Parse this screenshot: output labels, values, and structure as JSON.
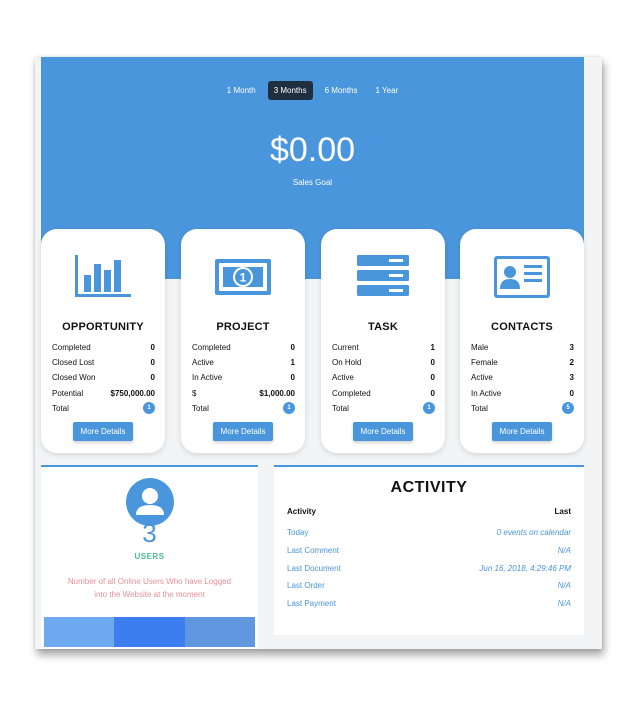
{
  "periods": [
    "1 Month",
    "3 Months",
    "6 Months",
    "1 Year"
  ],
  "active_period": "3 Months",
  "sales_goal": {
    "value": "$0.00",
    "label": "Sales Goal"
  },
  "accent_color": "#4a96dc",
  "cards": [
    {
      "title": "OPPORTUNITY",
      "icon": "bar-chart-icon",
      "rows": [
        {
          "label": "Completed",
          "value": "0"
        },
        {
          "label": "Closed Lost",
          "value": "0"
        },
        {
          "label": "Closed Won",
          "value": "0"
        },
        {
          "label": "Potential",
          "value": "$750,000.00"
        }
      ],
      "total_label": "Total",
      "total_badge": "1",
      "button": "More Details"
    },
    {
      "title": "PROJECT",
      "icon": "banknote-icon",
      "rows": [
        {
          "label": "Completed",
          "value": "0"
        },
        {
          "label": "Active",
          "value": "1"
        },
        {
          "label": "In Active",
          "value": "0"
        },
        {
          "label": "$",
          "value": "$1,000.00"
        }
      ],
      "total_label": "Total",
      "total_badge": "1",
      "button": "More Details"
    },
    {
      "title": "TASK",
      "icon": "task-list-icon",
      "rows": [
        {
          "label": "Current",
          "value": "1"
        },
        {
          "label": "On Hold",
          "value": "0"
        },
        {
          "label": "Active",
          "value": "0"
        },
        {
          "label": "Completed",
          "value": "0"
        }
      ],
      "total_label": "Total",
      "total_badge": "1",
      "button": "More Details"
    },
    {
      "title": "CONTACTS",
      "icon": "contact-card-icon",
      "rows": [
        {
          "label": "Male",
          "value": "3"
        },
        {
          "label": "Female",
          "value": "2"
        },
        {
          "label": "Active",
          "value": "3"
        },
        {
          "label": "In Active",
          "value": "0"
        }
      ],
      "total_label": "Total",
      "total_badge": "5",
      "button": "More Details"
    }
  ],
  "users": {
    "count": "3",
    "label": "USERS",
    "description": "Number of all Online Users Who have Logged into the Website at the moment"
  },
  "activity": {
    "title": "ACTIVITY",
    "col_activity": "Activity",
    "col_last": "Last",
    "rows": [
      {
        "label": "Today",
        "value": "0 events on calendar"
      },
      {
        "label": "Last Comment",
        "value": "N/A"
      },
      {
        "label": "Last Document",
        "value": "Jun 16, 2018, 4:29:46 PM"
      },
      {
        "label": "Last Order",
        "value": "N/A"
      },
      {
        "label": "Last Payment",
        "value": "N/A"
      }
    ]
  }
}
